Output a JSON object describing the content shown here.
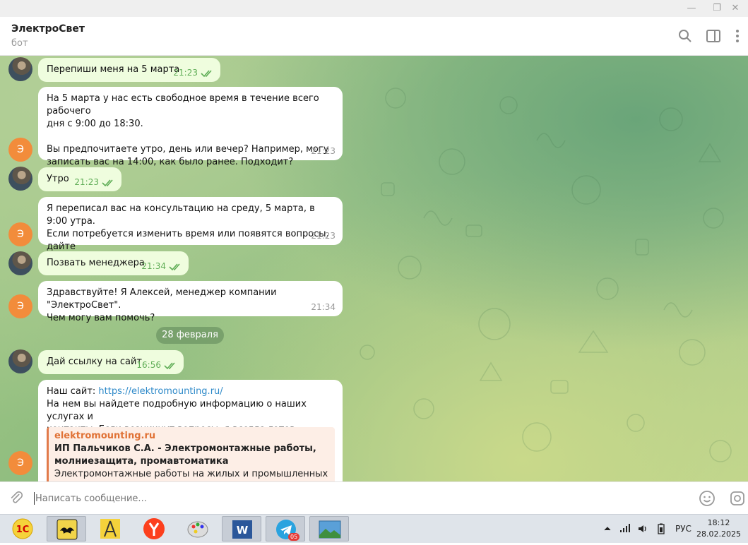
{
  "window": {
    "minimize": "—",
    "restore": "❐",
    "close": "✕"
  },
  "header": {
    "title": "ЭлектроСвет",
    "subtitle": "бот"
  },
  "messages": [
    {
      "text": "Перепиши меня на 5 марта",
      "time": "21:23"
    },
    {
      "text": "На 5 марта у нас есть свободное время в течение всего рабочего\nдня с 9:00 до 18:30.\n\nВы предпочитаете утро, день или вечер? Например, могу\nзаписать вас на 14:00, как было ранее. Подходит?",
      "time": "21:23"
    },
    {
      "text": "Утро",
      "time": "21:23"
    },
    {
      "text": "Я переписал вас на консультацию на среду, 5 марта, в 9:00 утра.\nЕсли потребуется изменить время или появятся вопросы, дайте\nзнать!",
      "time": "21:23"
    },
    {
      "text": "Позвать менеджера",
      "time": "21:34"
    },
    {
      "text": "Здравствуйте! Я Алексей, менеджер компании \"ЭлектроСвет\".\nЧем могу вам помочь?",
      "time": "21:34"
    },
    {
      "text": "Дай ссылку на сайт",
      "time": "16:56"
    },
    {
      "text_prefix": "Наш сайт: ",
      "link": "https://elektromounting.ru/",
      "text_rest": "На нем вы найдете подробную информацию о наших услугах и\nконтакты. Если возникнут вопросы, я всегда готов помочь!",
      "preview": {
        "site": "elektromounting.ru",
        "title": "ИП Пальчиков С.А. - Электромонтажные работы,\nмолниезащита, промавтоматика",
        "desc": "Электромонтажные работы на жилых и промышленных"
      }
    }
  ],
  "date_separator": "28 февраля",
  "bot_avatar_letter": "Э",
  "composer": {
    "placeholder": "Написать сообщение..."
  },
  "taskbar": {
    "language": "РУС",
    "time": "18:12",
    "date": "28.02.2025",
    "telegram_badge": "05",
    "app_1c": "1С",
    "app_word": "W"
  }
}
